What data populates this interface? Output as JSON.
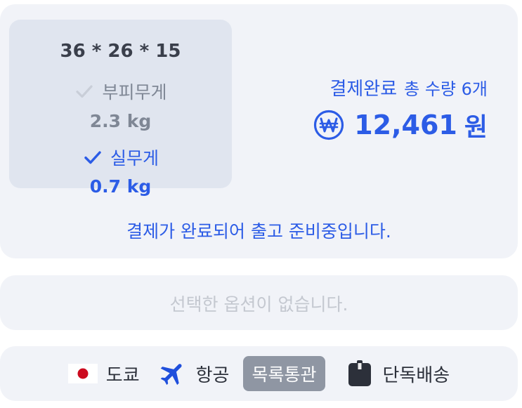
{
  "order": {
    "dimensions": "36 * 26 * 15",
    "volumetric_label": "부피무게",
    "volumetric_weight": "2.3 kg",
    "actual_label": "실무게",
    "actual_weight": "0.7 kg",
    "selected_weight_type": "actual",
    "payment_status": "결제완료",
    "total_quantity": "총 수량 6개",
    "amount": "12,461",
    "currency": "원",
    "status_message": "결제가 완료되어 출고 준비중입니다."
  },
  "options": {
    "empty_message": "선택한 옵션이 없습니다."
  },
  "shipping": {
    "origin": "도쿄",
    "method": "항공",
    "customs": "목록통관",
    "delivery_type": "단독배송"
  },
  "colors": {
    "accent": "#2c5ce6",
    "card_background": "#f1f3f8",
    "weight_box_background": "#e0e5ef",
    "muted_text": "#7f8795",
    "placeholder_text": "#c4c8d0",
    "badge_background": "#8f96a3"
  },
  "icons": {
    "volumetric_check": "check-icon",
    "actual_check": "check-icon",
    "currency": "won-circle-icon",
    "origin": "japan-flag-icon",
    "method": "airplane-icon",
    "delivery": "box-icon"
  }
}
